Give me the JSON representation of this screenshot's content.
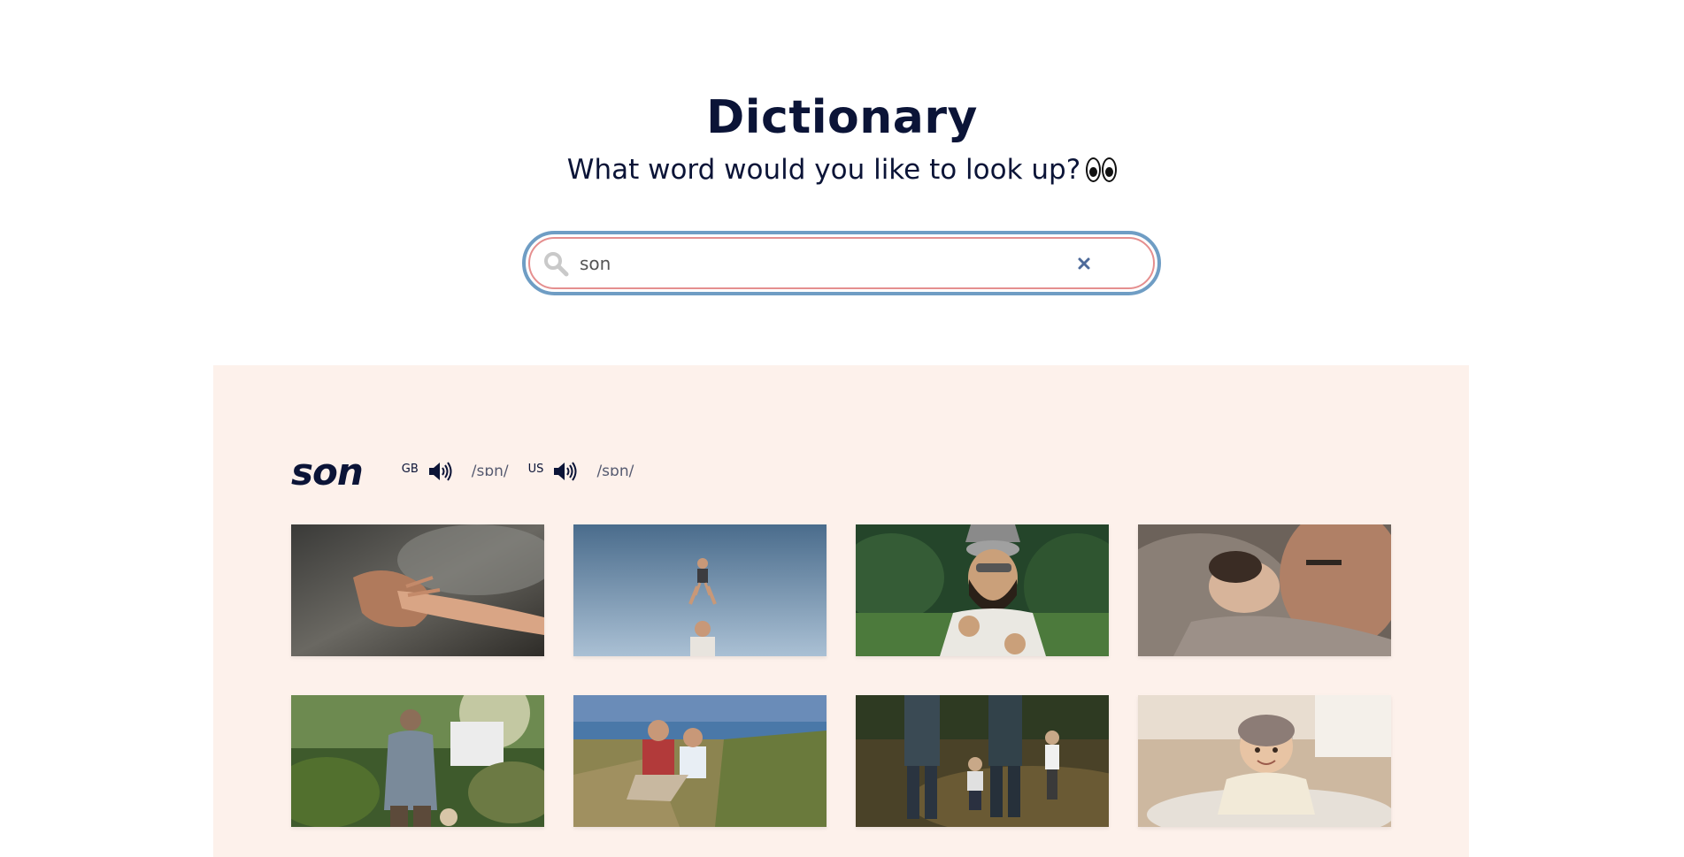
{
  "header": {
    "title": "Dictionary",
    "subtitle": "What word would you like to look up?",
    "subtitle_emoji": "eyes-emoji"
  },
  "search": {
    "value": "son",
    "placeholder": "",
    "icon": "search-icon",
    "clear_icon": "close-icon"
  },
  "result": {
    "word": "son",
    "pronunciations": [
      {
        "region": "GB",
        "phonetic": "/sɒn/",
        "icon": "speaker-icon"
      },
      {
        "region": "US",
        "phonetic": "/sɒn/",
        "icon": "speaker-icon"
      }
    ],
    "images": [
      {
        "subject": "adult hand holding child hand"
      },
      {
        "subject": "father tossing child into sky"
      },
      {
        "subject": "smiling bearded man with child on shoulders"
      },
      {
        "subject": "father cuddling newborn baby"
      },
      {
        "subject": "man walking in garden with toddler"
      },
      {
        "subject": "father and son laughing on beach dunes"
      },
      {
        "subject": "family walking holding toddler hands"
      },
      {
        "subject": "smiling baby in knit hat on rug"
      }
    ]
  },
  "colors": {
    "title": "#0b1437",
    "results_background": "#fdf1eb",
    "search_outer_border": "#6f9dc4",
    "search_inner_border": "#e58f8f",
    "clear_icon": "#4d6a9a"
  }
}
